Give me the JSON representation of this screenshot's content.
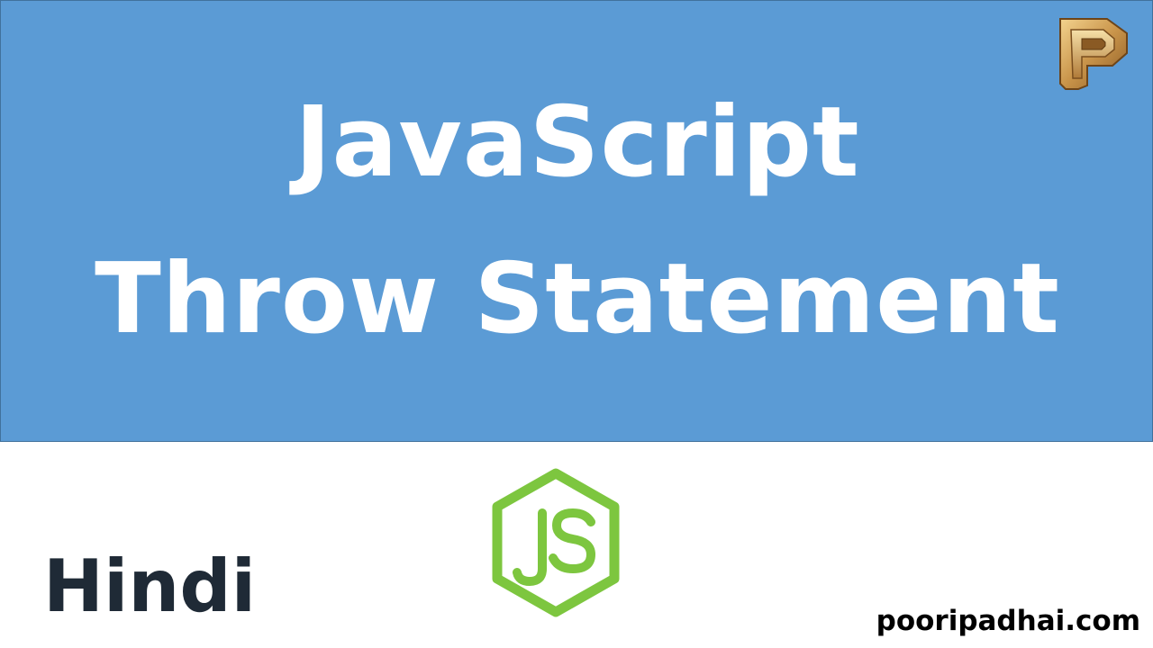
{
  "banner": {
    "title_line_1": "JavaScript",
    "title_line_2": "Throw Statement",
    "background_color": "#5b9bd5",
    "text_color": "#ffffff"
  },
  "logo": {
    "icon": "wooden-p-logo-icon",
    "letter": "P"
  },
  "language_label": "Hindi",
  "js_badge": {
    "icon": "nodejs-hexagon-icon",
    "text": "JS",
    "color": "#7dc63f"
  },
  "website": "pooripadhai.com"
}
